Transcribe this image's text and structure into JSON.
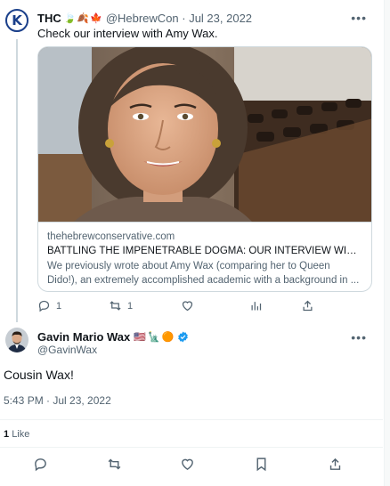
{
  "parent_tweet": {
    "avatar_letter": "K",
    "display_name": "THC",
    "name_emoji": "🍃🍂🍁",
    "handle_date": "@HebrewCon · Jul 23, 2022",
    "text": "Check our interview with Amy Wax.",
    "card": {
      "domain": "thehebrewconservative.com",
      "title": "BATTLING THE IMPENETRABLE DOGMA: OUR INTERVIEW WITH AMY...",
      "description": "We previously wrote about Amy Wax (comparing her to Queen Dido!), an extremely accomplished academic with a background in ..."
    },
    "actions": {
      "replies": "1",
      "retweets": "1"
    }
  },
  "main_tweet": {
    "display_name": "Gavin Mario Wax",
    "badges": [
      "🇺🇸",
      "🗽",
      "🟠"
    ],
    "handle": "@GavinWax",
    "text": "Cousin Wax!",
    "timestamp": "5:43 PM · Jul 23, 2022",
    "likes_count": "1",
    "likes_label": "Like"
  },
  "colors": {
    "text": "#0f1419",
    "muted": "#536471",
    "border": "#cfd9de",
    "verified": "#1d9bf0"
  }
}
